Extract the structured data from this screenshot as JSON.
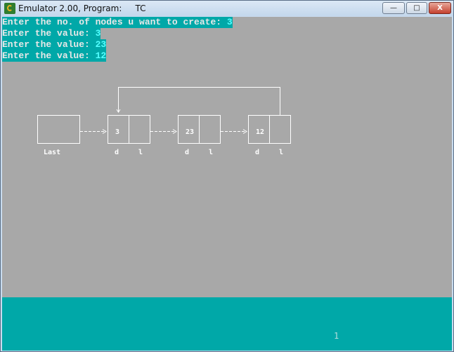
{
  "window": {
    "title": "Emulator 2.00, Program:",
    "program": "TC",
    "buttons": {
      "minimize": "—",
      "maximize": "□",
      "close": "X"
    }
  },
  "console": {
    "lines": [
      {
        "prompt": "Enter the no. of nodes u want to create: ",
        "value": "3"
      },
      {
        "prompt": "Enter the value: ",
        "value": "3"
      },
      {
        "prompt": "Enter the value: ",
        "value": "23"
      },
      {
        "prompt": "Enter the value: ",
        "value": "12"
      }
    ]
  },
  "diagram": {
    "last_label": "Last",
    "nodes": [
      {
        "value": "3",
        "data_label": "d",
        "link_label": "l"
      },
      {
        "value": "23",
        "data_label": "d",
        "link_label": "l"
      },
      {
        "value": "12",
        "data_label": "d",
        "link_label": "l"
      }
    ]
  },
  "status": {
    "page": "1"
  },
  "colors": {
    "screen": "#a8a8a8",
    "cyan": "#00a8a8",
    "text": "#ffffff"
  }
}
